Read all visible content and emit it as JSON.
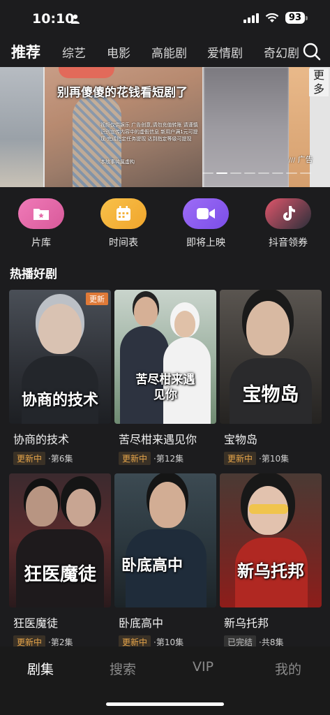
{
  "status": {
    "time": "10:10",
    "battery": "93"
  },
  "top_nav": {
    "tabs": [
      "推荐",
      "综艺",
      "电影",
      "高能剧",
      "爱情剧",
      "奇幻剧"
    ],
    "more": "更多"
  },
  "banner": {
    "headline": "别再傻傻的花钱看短剧了",
    "small_text": "视频仅供娱乐 广告创意,请勿充值转账 请谨慎识别宣传内容中的虚假信息 新用户满1元可提现 完成指定任务提现 达到指定等级可提现",
    "small_text2": "本故事纯属虚构",
    "ad_label": "广告"
  },
  "quick_actions": [
    {
      "label": "片库",
      "icon": "folder-icon",
      "color": "#e46aa8"
    },
    {
      "label": "时间表",
      "icon": "calendar-icon",
      "color": "#f3b23c"
    },
    {
      "label": "即将上映",
      "icon": "video-camera-icon",
      "color": "#8a5cf0"
    },
    {
      "label": "抖音领券",
      "icon": "tiktok-icon",
      "color": "#d4455a"
    }
  ],
  "section": {
    "title": "热播好剧"
  },
  "dramas": [
    {
      "title": "协商的技术",
      "poster_text": "协商的技术",
      "status": "更新中",
      "episodes": "·第6集",
      "badge": "更新"
    },
    {
      "title": "苦尽柑来遇见你",
      "poster_text": "苦尽柑来遇见你",
      "status": "更新中",
      "episodes": "·第12集"
    },
    {
      "title": "宝物岛",
      "poster_text": "宝物岛",
      "status": "更新中",
      "episodes": "·第10集"
    },
    {
      "title": "狂医魔徒",
      "poster_text": "狂医魔徒",
      "status": "更新中",
      "episodes": "·第2集"
    },
    {
      "title": "卧底高中",
      "poster_text": "卧底高中",
      "status": "更新中",
      "episodes": "·第10集"
    },
    {
      "title": "新乌托邦",
      "poster_text": "新乌托邦",
      "status": "已完结",
      "episodes": "·共8集"
    }
  ],
  "bottom_nav": [
    "剧集",
    "搜索",
    "VIP",
    "我的"
  ]
}
